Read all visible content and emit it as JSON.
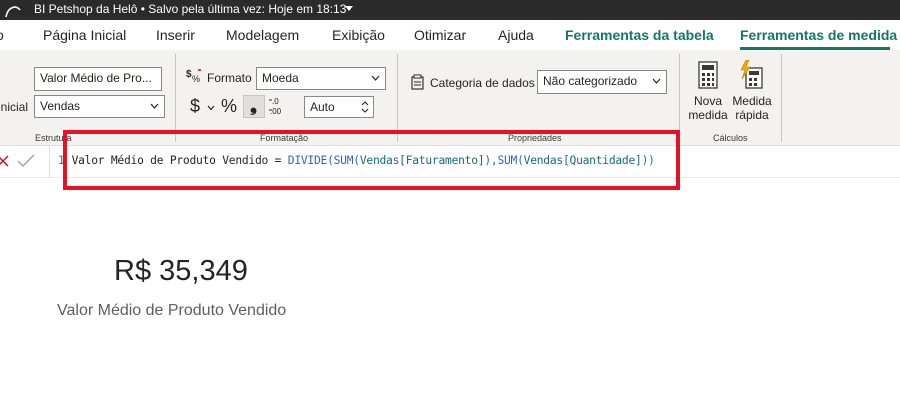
{
  "titlebar": {
    "title": "BI Petshop da Helô • Salvo pela última vez: Hoje em 18:13"
  },
  "menu": {
    "tabs": [
      {
        "label": "o"
      },
      {
        "label": "Página Inicial"
      },
      {
        "label": "Inserir"
      },
      {
        "label": "Modelagem"
      },
      {
        "label": "Exibição"
      },
      {
        "label": "Otimizar"
      },
      {
        "label": "Ajuda"
      },
      {
        "label": "Ferramentas da tabela"
      },
      {
        "label": "Ferramentas de medida"
      }
    ],
    "accent_color": "#117865"
  },
  "ribbon": {
    "estrutura": {
      "name_value": "Valor Médio de Pro...",
      "home_table_label": "inicial",
      "home_table_value": "Vendas",
      "group_label": "Estrutura"
    },
    "formatacao": {
      "format_label": "Formato",
      "format_value": "Moeda",
      "currency_symbol": "$",
      "percent_symbol": "%",
      "comma_symbol": "❟",
      "decimals_value": "Auto",
      "group_label": "Formatação"
    },
    "propriedades": {
      "category_label": "Categoria de dados",
      "category_value": "Não categorizado",
      "group_label": "Propriedades"
    },
    "calculos": {
      "new_measure_line1": "Nova",
      "new_measure_line2": "medida",
      "quick_measure_line1": "Medida",
      "quick_measure_line2": "rápida",
      "group_label": "Cálculos"
    }
  },
  "formula_bar": {
    "line_number": "1",
    "measure_name": "Valor Médio de Produto Vendido = ",
    "fn_divide": "DIVIDE(",
    "fn_sum1": "SUM(",
    "table1": "Vendas",
    "col1": "[Faturamento]",
    "close1": "),",
    "fn_sum2": "SUM(",
    "table2": "Vendas",
    "col2": "[Quantidade]",
    "close2": "))",
    "highlight_color": "#e81123"
  },
  "card": {
    "value": "R$ 35,349",
    "label": "Valor Médio de Produto Vendido"
  }
}
